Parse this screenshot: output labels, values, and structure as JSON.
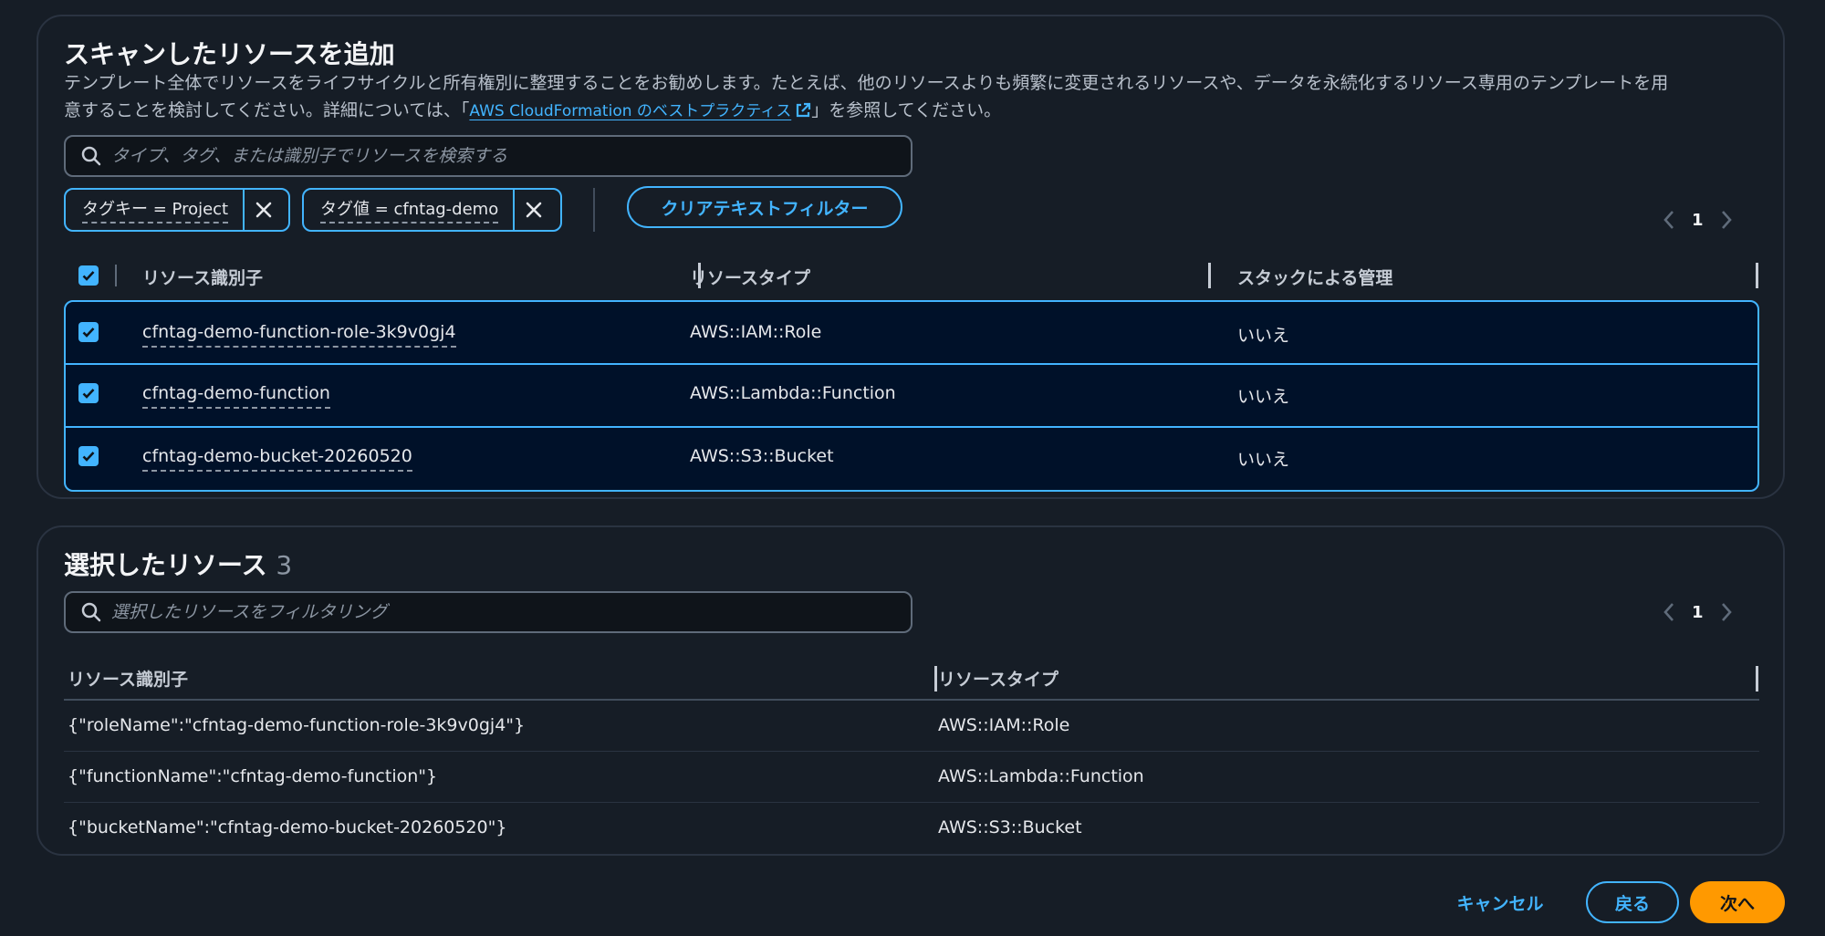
{
  "scan_panel": {
    "title": "スキャンしたリソースを追加",
    "desc_line1": "テンプレート全体でリソースをライフサイクルと所有権別に整理することをお勧めします。たとえば、他のリソースよりも頻繁に変更されるリソースや、データを永続化するリソース専用のテンプレートを用",
    "desc_line2_pre": "意することを検討してください。詳細については、「",
    "desc_link": "AWS CloudFormation のベストプラクティス",
    "desc_line2_post": "」を参照してください。",
    "search_placeholder": "タイプ、タグ、または識別子でリソースを検索する",
    "filters": [
      {
        "label": "タグキー = Project"
      },
      {
        "label": "タグ値 = cfntag-demo"
      }
    ],
    "clear_button": "クリアテキストフィルター",
    "page": "1",
    "columns": [
      "リソース識別子",
      "リソースタイプ",
      "スタックによる管理"
    ],
    "rows": [
      {
        "id": "cfntag-demo-function-role-3k9v0gj4",
        "type": "AWS::IAM::Role",
        "managed": "いいえ"
      },
      {
        "id": "cfntag-demo-function",
        "type": "AWS::Lambda::Function",
        "managed": "いいえ"
      },
      {
        "id": "cfntag-demo-bucket-20260520",
        "type": "AWS::S3::Bucket",
        "managed": "いいえ"
      }
    ]
  },
  "selected_panel": {
    "title": "選択したリソース",
    "count": "3",
    "search_placeholder": "選択したリソースをフィルタリング",
    "page": "1",
    "columns": [
      "リソース識別子",
      "リソースタイプ"
    ],
    "rows": [
      {
        "id": "{\"roleName\":\"cfntag-demo-function-role-3k9v0gj4\"}",
        "type": "AWS::IAM::Role"
      },
      {
        "id": "{\"functionName\":\"cfntag-demo-function\"}",
        "type": "AWS::Lambda::Function"
      },
      {
        "id": "{\"bucketName\":\"cfntag-demo-bucket-20260520\"}",
        "type": "AWS::S3::Bucket"
      }
    ]
  },
  "footer": {
    "cancel": "キャンセル",
    "back": "戻る",
    "next": "次へ"
  },
  "colors": {
    "accent": "#42b4ff",
    "primary_button": "#ff9900",
    "background": "#161d26",
    "selected_row_bg": "#001129"
  }
}
